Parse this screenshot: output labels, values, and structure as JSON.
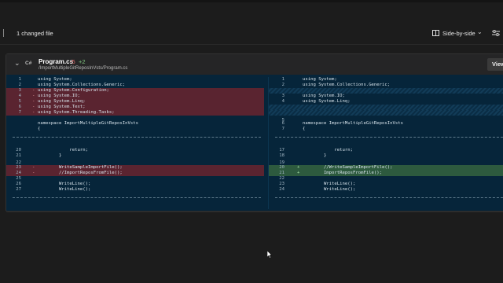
{
  "toolbar": {
    "changed_files": "1 changed file",
    "view_mode": "Side-by-side"
  },
  "file": {
    "name": "Program.cs",
    "removed": "-5",
    "added": "+2",
    "path": "/ImportMultipleGitReposInVsts/Program.cs",
    "icon_label": "C#",
    "view_button": "View"
  },
  "left": [
    {
      "ln": "1",
      "mk": "",
      "code": "using System;",
      "t": ""
    },
    {
      "ln": "2",
      "mk": "",
      "code": "using System.Collections.Generic;",
      "t": ""
    },
    {
      "ln": "3",
      "mk": "-",
      "code": "using System.Configuration;",
      "t": "del"
    },
    {
      "ln": "4",
      "mk": "-",
      "code": "using System.IO;",
      "t": "del"
    },
    {
      "ln": "5",
      "mk": "-",
      "code": "using System.Linq;",
      "t": "del"
    },
    {
      "ln": "6",
      "mk": "-",
      "code": "using System.Text;",
      "t": "del"
    },
    {
      "ln": "7",
      "mk": "-",
      "code": "using System.Threading.Tasks;",
      "t": "del"
    },
    {
      "ln": "",
      "mk": "",
      "code": "",
      "t": ""
    },
    {
      "ln": "",
      "mk": "",
      "code": "namespace ImportMultipleGitReposInVsts",
      "t": ""
    },
    {
      "ln": "",
      "mk": "",
      "code": "{",
      "t": ""
    },
    {
      "ln": "20",
      "mk": "",
      "code": "            return;",
      "t": ""
    },
    {
      "ln": "21",
      "mk": "",
      "code": "        }",
      "t": ""
    },
    {
      "ln": "22",
      "mk": "",
      "code": "",
      "t": ""
    },
    {
      "ln": "23",
      "mk": "-",
      "code": "        WriteSampleImportFile();",
      "t": "del"
    },
    {
      "ln": "24",
      "mk": "-",
      "code": "        //ImportReposFromFile();",
      "t": "del"
    },
    {
      "ln": "25",
      "mk": "",
      "code": "",
      "t": ""
    },
    {
      "ln": "26",
      "mk": "",
      "code": "        WriteLine();",
      "t": ""
    },
    {
      "ln": "27",
      "mk": "",
      "code": "        WriteLine();",
      "t": ""
    }
  ],
  "right": [
    {
      "ln": "1",
      "mk": "",
      "code": "using System;",
      "t": ""
    },
    {
      "ln": "2",
      "mk": "",
      "code": "using System.Collections.Generic;",
      "t": ""
    },
    {
      "ln": "",
      "mk": "",
      "code": "",
      "t": "hatch"
    },
    {
      "ln": "3",
      "mk": "",
      "code": "using System.IO;",
      "t": ""
    },
    {
      "ln": "4",
      "mk": "",
      "code": "using System.Linq;",
      "t": ""
    },
    {
      "ln": "",
      "mk": "",
      "code": "",
      "t": "hatch"
    },
    {
      "ln": "",
      "mk": "",
      "code": "",
      "t": "hatch"
    },
    {
      "ln": "5",
      "mk": "",
      "code": "",
      "t": ""
    },
    {
      "ln": "6",
      "mk": "",
      "code": "namespace ImportMultipleGitReposInVsts",
      "t": ""
    },
    {
      "ln": "7",
      "mk": "",
      "code": "{",
      "t": ""
    },
    {
      "ln": "17",
      "mk": "",
      "code": "            return;",
      "t": ""
    },
    {
      "ln": "18",
      "mk": "",
      "code": "        }",
      "t": ""
    },
    {
      "ln": "19",
      "mk": "",
      "code": "",
      "t": ""
    },
    {
      "ln": "20",
      "mk": "+",
      "code": "        //WriteSampleImportFile();",
      "t": "ins"
    },
    {
      "ln": "21",
      "mk": "+",
      "code": "        ImportReposFromFile();",
      "t": "ins"
    },
    {
      "ln": "22",
      "mk": "",
      "code": "",
      "t": ""
    },
    {
      "ln": "23",
      "mk": "",
      "code": "        WriteLine();",
      "t": ""
    },
    {
      "ln": "24",
      "mk": "",
      "code": "        WriteLine();",
      "t": ""
    }
  ]
}
